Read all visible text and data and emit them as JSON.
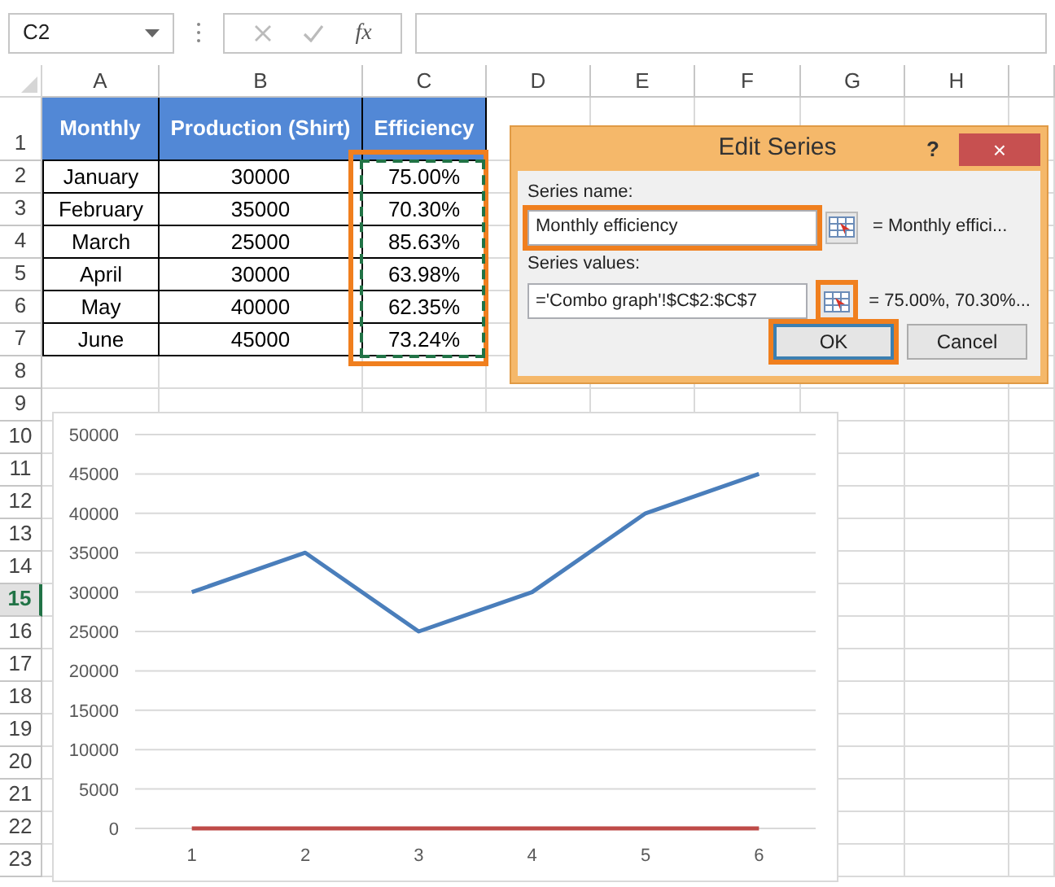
{
  "formula_bar": {
    "name_box": "C2",
    "function_label": "fx"
  },
  "columns": [
    "A",
    "B",
    "C",
    "D",
    "E",
    "F",
    "G",
    "H"
  ],
  "row_headers": [
    {
      "label": "1",
      "selected": false
    },
    {
      "label": "2",
      "selected": false
    },
    {
      "label": "3",
      "selected": false
    },
    {
      "label": "4",
      "selected": false
    },
    {
      "label": "5",
      "selected": false
    },
    {
      "label": "6",
      "selected": false
    },
    {
      "label": "7",
      "selected": false
    },
    {
      "label": "8",
      "selected": false
    },
    {
      "label": "9",
      "selected": false
    },
    {
      "label": "10",
      "selected": false
    },
    {
      "label": "11",
      "selected": false
    },
    {
      "label": "12",
      "selected": false
    },
    {
      "label": "13",
      "selected": false
    },
    {
      "label": "14",
      "selected": false
    },
    {
      "label": "15",
      "selected": true
    },
    {
      "label": "16",
      "selected": false
    },
    {
      "label": "17",
      "selected": false
    },
    {
      "label": "18",
      "selected": false
    },
    {
      "label": "19",
      "selected": false
    },
    {
      "label": "20",
      "selected": false
    },
    {
      "label": "21",
      "selected": false
    },
    {
      "label": "22",
      "selected": false
    },
    {
      "label": "23",
      "selected": false
    }
  ],
  "table": {
    "header": [
      "Monthly",
      "Production (Shirt)",
      "Efficiency"
    ],
    "rows": [
      [
        "January",
        "30000",
        "75.00%"
      ],
      [
        "February",
        "35000",
        "70.30%"
      ],
      [
        "March",
        "25000",
        "85.63%"
      ],
      [
        "April",
        "30000",
        "63.98%"
      ],
      [
        "May",
        "40000",
        "62.35%"
      ],
      [
        "June",
        "45000",
        "73.24%"
      ]
    ],
    "efficiency_column_highlighted": true,
    "copy_range_marked": true
  },
  "chart": {
    "chart_data": {
      "type": "line",
      "grid": true,
      "categories": [
        "1",
        "2",
        "3",
        "4",
        "5",
        "6"
      ],
      "ylim": [
        0,
        50000
      ],
      "yticks": [
        0,
        5000,
        10000,
        15000,
        20000,
        25000,
        30000,
        35000,
        40000,
        45000,
        50000
      ],
      "series": [
        {
          "color": "#4a7ebb",
          "values": [
            30000,
            35000,
            25000,
            30000,
            40000,
            45000
          ]
        },
        {
          "color": "#be4b48",
          "values": [
            0.75,
            0.703,
            0.8563,
            0.6398,
            0.6235,
            0.7324
          ]
        }
      ]
    }
  },
  "dialog": {
    "title": "Edit Series",
    "help": "?",
    "close": "×",
    "name_label": "Series name:",
    "name_value": "Monthly efficiency",
    "name_highlighted": true,
    "name_preview": "= Monthly effici...",
    "values_label": "Series values:",
    "values_value": "='Combo graph'!$C$2:$C$7",
    "values_picker_highlighted": true,
    "values_preview": "= 75.00%, 70.30%...",
    "buttons": [
      {
        "label": "OK",
        "default": true,
        "highlighted": true
      },
      {
        "label": "Cancel",
        "default": false,
        "highlighted": false
      }
    ]
  }
}
